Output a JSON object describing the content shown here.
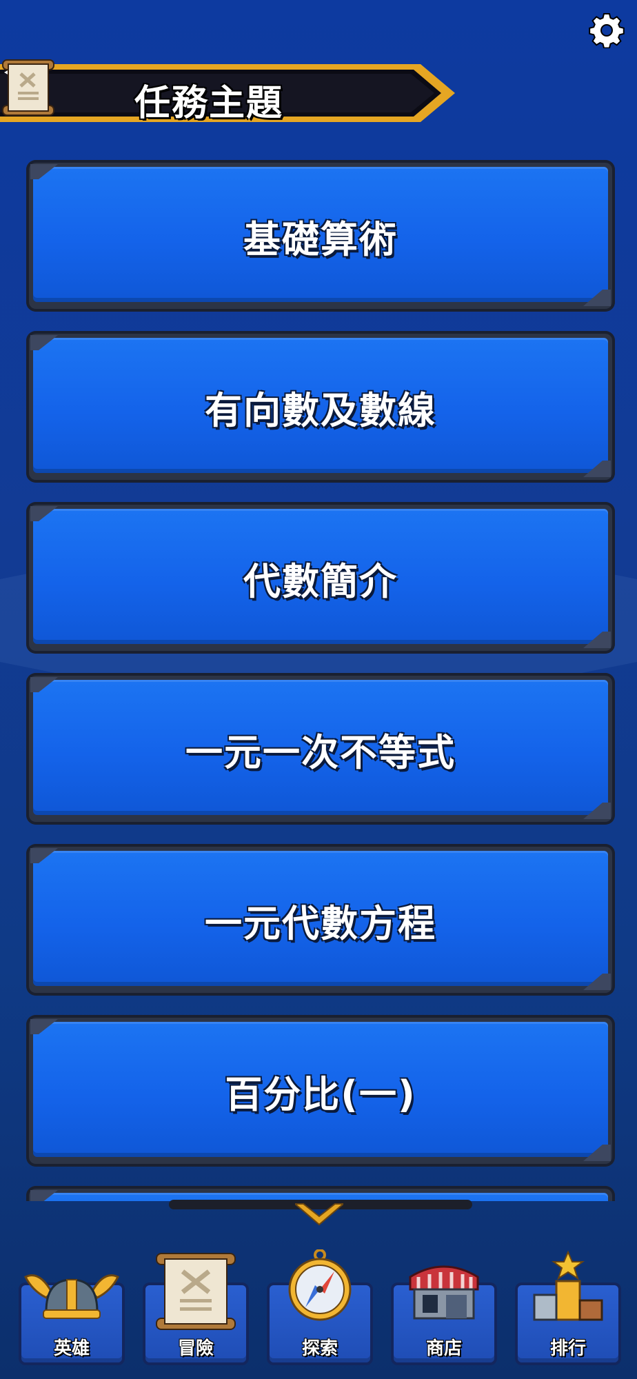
{
  "header": {
    "title": "任務主題"
  },
  "topics": [
    {
      "label": "基礎算術"
    },
    {
      "label": "有向數及數線"
    },
    {
      "label": "代數簡介"
    },
    {
      "label": "一元一次不等式"
    },
    {
      "label": "一元代數方程"
    },
    {
      "label": "百分比(一)"
    },
    {
      "label": ""
    }
  ],
  "nav": {
    "items": [
      {
        "label": "英雄",
        "icon": "helmet-icon"
      },
      {
        "label": "冒險",
        "icon": "scroll-icon"
      },
      {
        "label": "探索",
        "icon": "compass-icon"
      },
      {
        "label": "商店",
        "icon": "shop-icon"
      },
      {
        "label": "排行",
        "icon": "podium-icon"
      }
    ]
  },
  "colors": {
    "background": "#0d3aa0",
    "button_blue": "#1463ea",
    "frame_dark": "#2c3446",
    "ribbon_gold": "#e5a623"
  }
}
